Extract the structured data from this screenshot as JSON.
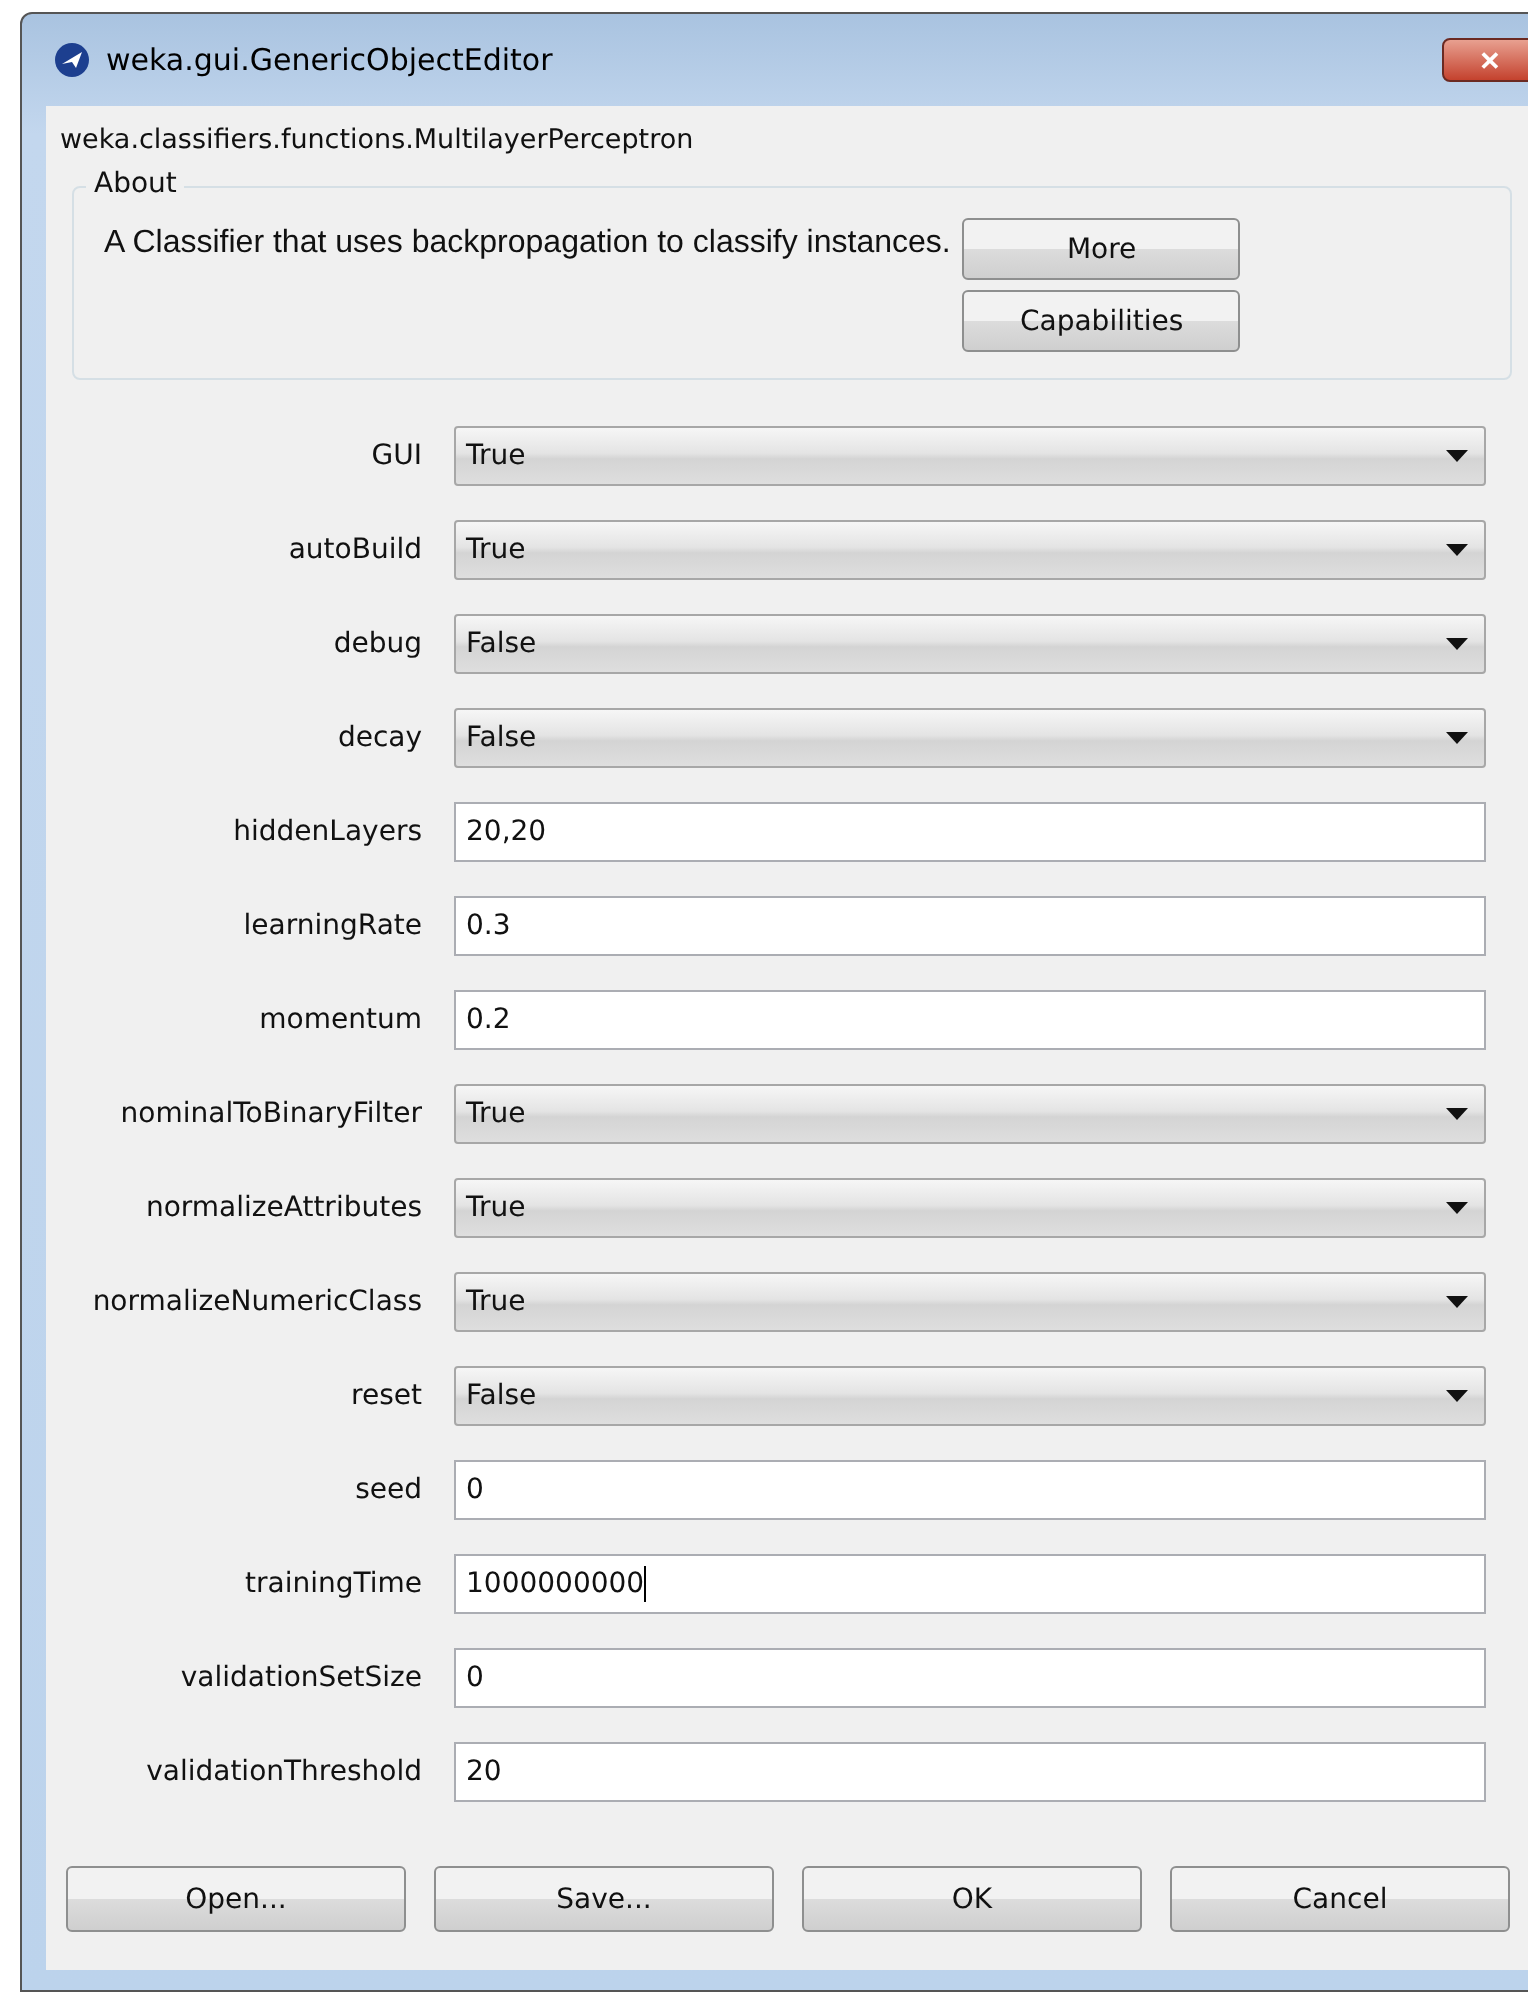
{
  "window": {
    "title": "weka.gui.GenericObjectEditor",
    "close": "✕"
  },
  "class_name": "weka.classifiers.functions.MultilayerPerceptron",
  "about": {
    "title": "About",
    "text": "A Classifier that uses backpropagation to classify instances.",
    "buttons": [
      "More",
      "Capabilities"
    ]
  },
  "properties": [
    {
      "label": "GUI",
      "kind": "dropdown",
      "value": "True"
    },
    {
      "label": "autoBuild",
      "kind": "dropdown",
      "value": "True"
    },
    {
      "label": "debug",
      "kind": "dropdown",
      "value": "False"
    },
    {
      "label": "decay",
      "kind": "dropdown",
      "value": "False"
    },
    {
      "label": "hiddenLayers",
      "kind": "text",
      "value": "20,20",
      "focused": false
    },
    {
      "label": "learningRate",
      "kind": "text",
      "value": "0.3",
      "focused": false
    },
    {
      "label": "momentum",
      "kind": "text",
      "value": "0.2",
      "focused": false
    },
    {
      "label": "nominalToBinaryFilter",
      "kind": "dropdown",
      "value": "True"
    },
    {
      "label": "normalizeAttributes",
      "kind": "dropdown",
      "value": "True"
    },
    {
      "label": "normalizeNumericClass",
      "kind": "dropdown",
      "value": "True"
    },
    {
      "label": "reset",
      "kind": "dropdown",
      "value": "False"
    },
    {
      "label": "seed",
      "kind": "text",
      "value": "0",
      "focused": false
    },
    {
      "label": "trainingTime",
      "kind": "text",
      "value": "1000000000",
      "focused": true
    },
    {
      "label": "validationSetSize",
      "kind": "text",
      "value": "0",
      "focused": false
    },
    {
      "label": "validationThreshold",
      "kind": "text",
      "value": "20",
      "focused": false
    }
  ],
  "buttons": [
    "Open...",
    "Save...",
    "OK",
    "Cancel"
  ]
}
